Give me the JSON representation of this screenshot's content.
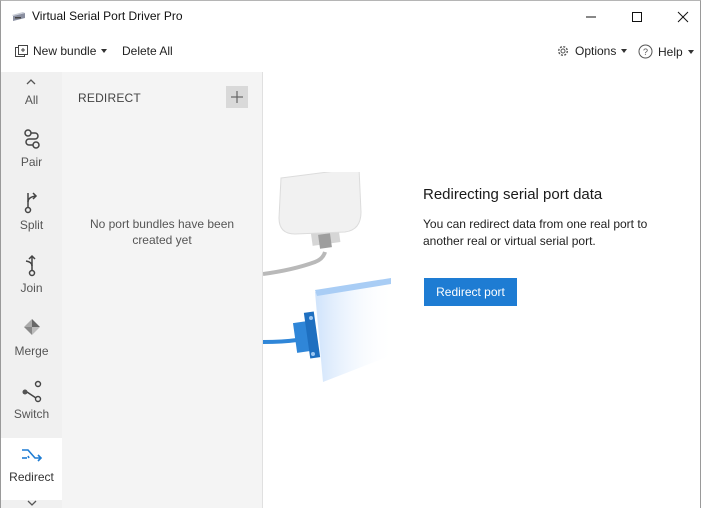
{
  "window": {
    "title": "Virtual Serial Port Driver Pro",
    "controls": [
      "minimize-icon",
      "maximize-icon",
      "close-icon"
    ]
  },
  "toolbar": {
    "new_bundle_label": "New bundle",
    "delete_all_label": "Delete All",
    "options_label": "Options",
    "help_label": "Help"
  },
  "sidebar": {
    "items": [
      {
        "label": "All",
        "icon": "chevron-up-icon"
      },
      {
        "label": "Pair",
        "icon": "pair-icon"
      },
      {
        "label": "Split",
        "icon": "split-icon"
      },
      {
        "label": "Join",
        "icon": "join-icon"
      },
      {
        "label": "Merge",
        "icon": "merge-icon"
      },
      {
        "label": "Switch",
        "icon": "switch-icon"
      },
      {
        "label": "Redirect",
        "icon": "redirect-icon",
        "active": true
      }
    ]
  },
  "list_panel": {
    "title": "REDIRECT",
    "empty_message": "No port bundles have been created yet"
  },
  "main": {
    "heading": "Redirecting serial port data",
    "description": "You can redirect data from one real port to another real or virtual serial port.",
    "button_label": "Redirect port"
  },
  "colors": {
    "accent": "#1e7cd3",
    "sidebar_bg": "#f0f0f0",
    "panel_bg": "#f4f4f4"
  }
}
